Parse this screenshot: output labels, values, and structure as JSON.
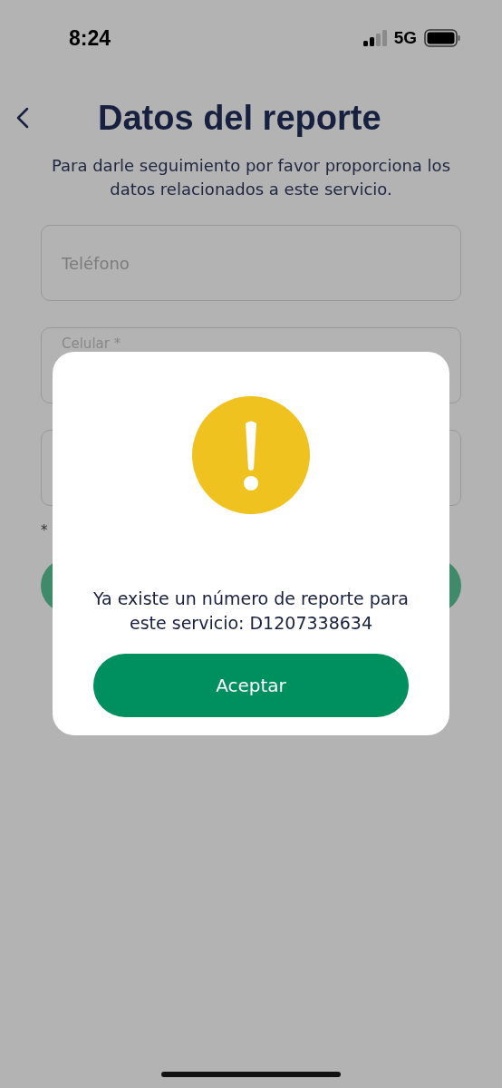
{
  "status_bar": {
    "time": "8:24",
    "network": "5G"
  },
  "header": {
    "title": "Datos del reporte",
    "subtitle": "Para darle seguimiento por favor proporciona los datos relacionados a este servicio."
  },
  "fields": [
    {
      "placeholder": "Teléfono",
      "kind": "placeholder"
    },
    {
      "label": "Celular *",
      "kind": "floating"
    },
    {
      "kind": "empty"
    }
  ],
  "note": "*",
  "dialog": {
    "message": "Ya existe un número de reporte para este servicio: D1207338634",
    "button": "Aceptar"
  }
}
